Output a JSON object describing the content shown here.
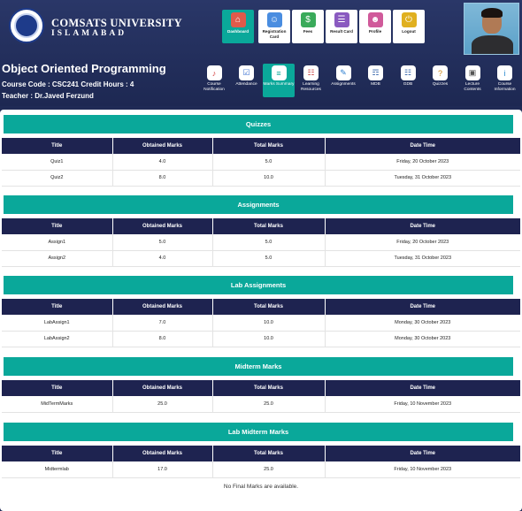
{
  "university": {
    "name": "COMSATS UNIVERSITY",
    "city": "ISLAMABAD"
  },
  "course": {
    "title": "Object Oriented Programming",
    "meta": "Course Code : CSC241    Credit Hours : 4",
    "teacher": "Teacher : Dr.Javed Ferzund"
  },
  "topnav": [
    {
      "label": "Dashboard",
      "icon": "house-icon",
      "color": "#e05a4a"
    },
    {
      "label": "Registration Card",
      "icon": "registration-card-icon",
      "color": "#4a8de0"
    },
    {
      "label": "Fees",
      "icon": "money-icon",
      "color": "#3aaa5a"
    },
    {
      "label": "Result Card",
      "icon": "result-card-icon",
      "color": "#8a5ac0"
    },
    {
      "label": "Profile",
      "icon": "person-icon",
      "color": "#d05a9a"
    },
    {
      "label": "Logout",
      "icon": "logout-icon",
      "color": "#e0b020"
    }
  ],
  "subnav": [
    {
      "label": "Course Notification",
      "icon": "notification-icon"
    },
    {
      "label": "Attendance",
      "icon": "attendance-icon"
    },
    {
      "label": "Marks Summary",
      "icon": "marks-summary-icon"
    },
    {
      "label": "Learning Resources",
      "icon": "learning-resources-icon"
    },
    {
      "label": "Assignments",
      "icon": "assignments-icon"
    },
    {
      "label": "MDB",
      "icon": "mdb-icon"
    },
    {
      "label": "GDB",
      "icon": "gdb-icon"
    },
    {
      "label": "Quizzes",
      "icon": "quizzes-icon"
    },
    {
      "label": "Lecture Contents",
      "icon": "lecture-contents-icon"
    },
    {
      "label": "Course Information",
      "icon": "info-icon"
    }
  ],
  "columns": [
    "Title",
    "Obtained Marks",
    "Total Marks",
    "Date Time"
  ],
  "sections": [
    {
      "title": "Quizzes",
      "rows": [
        [
          "Quiz1",
          "4.0",
          "5.0",
          "Friday, 20 October 2023"
        ],
        [
          "Quiz2",
          "8.0",
          "10.0",
          "Tuesday, 31 October 2023"
        ]
      ]
    },
    {
      "title": "Assignments",
      "rows": [
        [
          "Assign1",
          "5.0",
          "5.0",
          "Friday, 20 October 2023"
        ],
        [
          "Assign2",
          "4.0",
          "5.0",
          "Tuesday, 31 October 2023"
        ]
      ]
    },
    {
      "title": "Lab Assignments",
      "rows": [
        [
          "LabAssign1",
          "7.0",
          "10.0",
          "Monday, 30 October 2023"
        ],
        [
          "LabAssign2",
          "8.0",
          "10.0",
          "Monday, 30 October 2023"
        ]
      ]
    },
    {
      "title": "Midterm Marks",
      "rows": [
        [
          "MidTermMarks",
          "25.0",
          "25.0",
          "Friday, 10 November 2023"
        ]
      ]
    },
    {
      "title": "Lab Midterm Marks",
      "rows": [
        [
          "Midtermlab",
          "17.0",
          "25.0",
          "Friday, 10 November 2023"
        ]
      ]
    }
  ],
  "no_final_text": "No Final Marks are available."
}
